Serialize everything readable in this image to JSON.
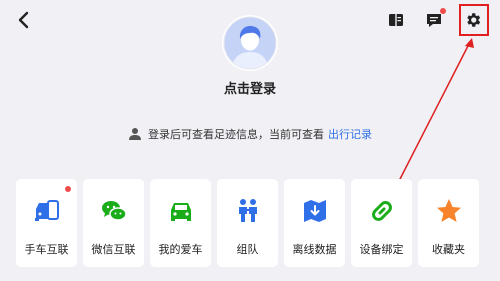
{
  "header": {
    "back_icon": "chevron-left-icon",
    "icons": [
      "book-icon",
      "message-icon",
      "gear-icon"
    ],
    "message_badge_color": "#f04b4b"
  },
  "profile": {
    "avatar_icon": "user-avatar-icon",
    "login_label": "点击登录"
  },
  "notice": {
    "text": "登录后可查看足迹信息，当前可查看",
    "link": "出行记录",
    "link_color": "#2f6fe8"
  },
  "tiles": [
    {
      "label": "手车互联",
      "icon": "car-phone-icon",
      "color": "#2f6fe8",
      "badge": true
    },
    {
      "label": "微信互联",
      "icon": "wechat-icon",
      "color": "#1aad19",
      "badge": false
    },
    {
      "label": "我的爱车",
      "icon": "car-icon",
      "color": "#1aad19",
      "badge": false
    },
    {
      "label": "组队",
      "icon": "team-icon",
      "color": "#2f6fe8",
      "badge": false
    },
    {
      "label": "离线数据",
      "icon": "offline-map-icon",
      "color": "#2f6fe8",
      "badge": false
    },
    {
      "label": "设备绑定",
      "icon": "link-icon",
      "color": "#1aad19",
      "badge": false
    },
    {
      "label": "收藏夹",
      "icon": "star-icon",
      "color": "#f7842a",
      "badge": false
    }
  ]
}
